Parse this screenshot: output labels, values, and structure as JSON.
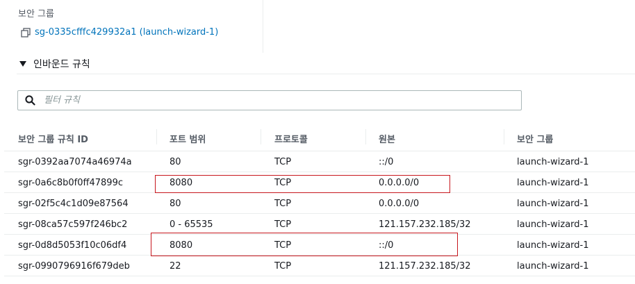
{
  "security_group": {
    "label": "보안 그룹",
    "link_text": "sg-0335cfffc429932a1 (launch-wizard-1)"
  },
  "inbound": {
    "title": "인바운드 규칙"
  },
  "search": {
    "placeholder": "필터 규칙"
  },
  "table": {
    "headers": [
      "보안 그룹 규칙 ID",
      "포트 범위",
      "프로토콜",
      "원본",
      "보안 그룹"
    ],
    "rows": [
      [
        "sgr-0392aa7074a46974a",
        "80",
        "TCP",
        "::/0",
        "launch-wizard-1"
      ],
      [
        "sgr-0a6c8b0f0ff47899c",
        "8080",
        "TCP",
        "0.0.0.0/0",
        "launch-wizard-1"
      ],
      [
        "sgr-02f5c4c1d09e87564",
        "80",
        "TCP",
        "0.0.0.0/0",
        "launch-wizard-1"
      ],
      [
        "sgr-08ca57c597f246bc2",
        "0 - 65535",
        "TCP",
        "121.157.232.185/32",
        "launch-wizard-1"
      ],
      [
        "sgr-0d8d5053f10c06df4",
        "8080",
        "TCP",
        "::/0",
        "launch-wizard-1"
      ],
      [
        "sgr-0990796916f679deb",
        "22",
        "TCP",
        "121.157.232.185/32",
        "launch-wizard-1"
      ]
    ]
  },
  "colors": {
    "link": "#0073bb",
    "highlight": "#c7161d",
    "header_text": "#545b64"
  }
}
